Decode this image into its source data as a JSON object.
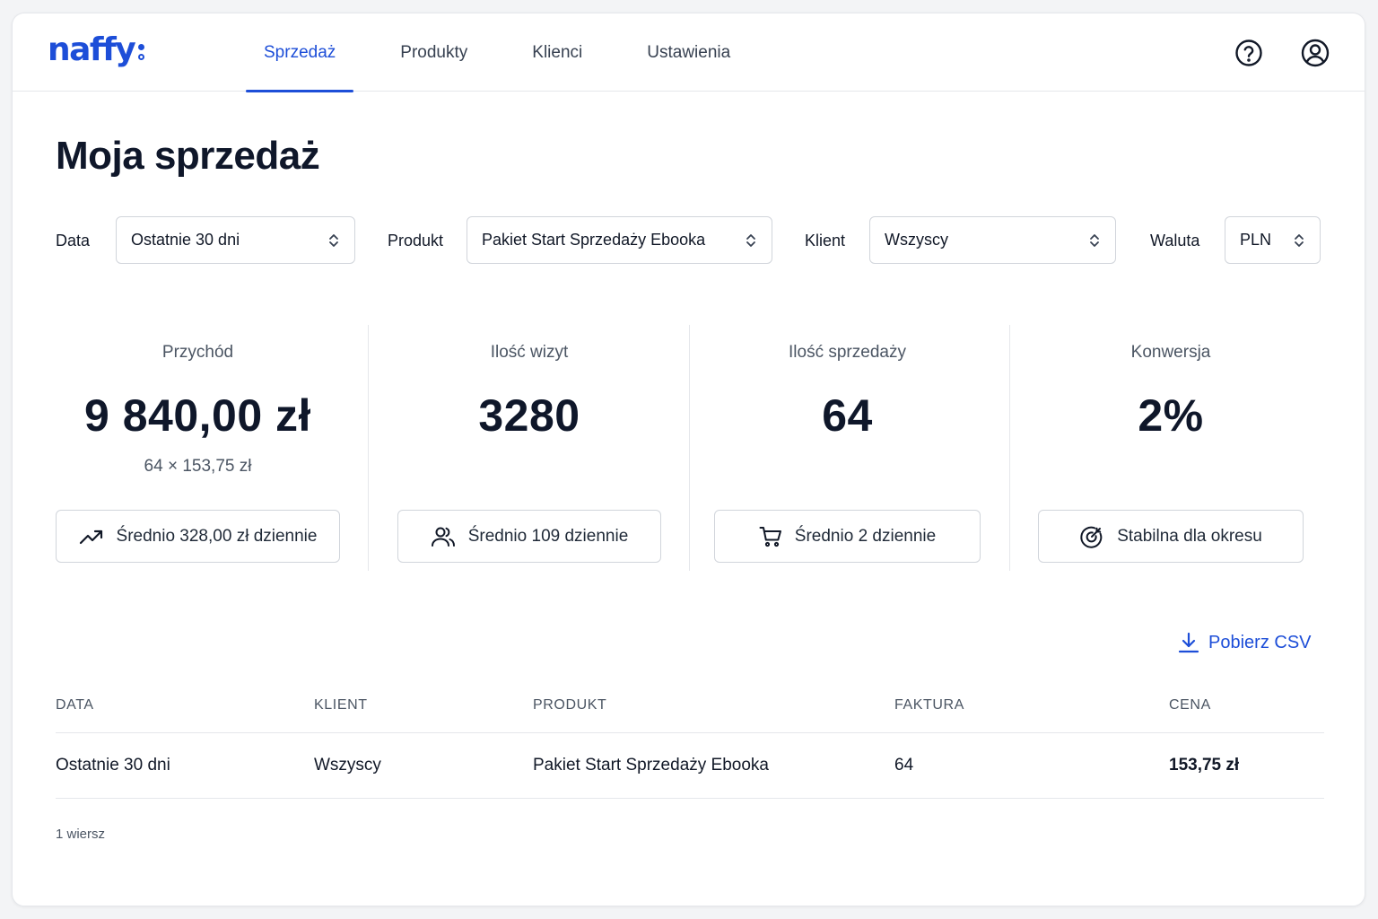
{
  "brand": {
    "name": "naffy"
  },
  "nav": {
    "tabs": [
      {
        "label": "Sprzedaż",
        "active": true
      },
      {
        "label": "Produkty",
        "active": false
      },
      {
        "label": "Klienci",
        "active": false
      },
      {
        "label": "Ustawienia",
        "active": false
      }
    ]
  },
  "header": {
    "help_icon": "question-circle-icon",
    "user_icon": "user-circle-icon"
  },
  "page": {
    "title": "Moja sprzedaż"
  },
  "filters": {
    "date": {
      "label": "Data",
      "value": "Ostatnie 30 dni"
    },
    "product": {
      "label": "Produkt",
      "value": "Pakiet Start Sprzedaży Ebooka"
    },
    "client": {
      "label": "Klient",
      "value": "Wszyscy"
    },
    "currency": {
      "label": "Waluta",
      "value": "PLN"
    }
  },
  "stats": {
    "revenue": {
      "label": "Przychód",
      "value": "9 840,00 zł",
      "sub": "64 × 153,75 zł",
      "note": "Średnio 328,00 zł dziennie",
      "icon": "trending-up-icon"
    },
    "visits": {
      "label": "Ilość wizyt",
      "value": "3280",
      "note": "Średnio 109 dziennie",
      "icon": "users-icon"
    },
    "sales": {
      "label": "Ilość sprzedaży",
      "value": "64",
      "note": "Średnio 2 dziennie",
      "icon": "cart-icon"
    },
    "conversion": {
      "label": "Konwersja",
      "value": "2%",
      "note": "Stabilna dla okresu",
      "icon": "target-icon"
    }
  },
  "actions": {
    "csv_label": "Pobierz CSV",
    "csv_icon": "download-icon"
  },
  "table": {
    "headers": [
      "DATA",
      "KLIENT",
      "PRODUKT",
      "FAKTURA",
      "CENA"
    ],
    "rows": [
      [
        "Ostatnie 30 dni",
        "Wszyscy",
        "Pakiet Start Sprzedaży Ebooka",
        "64",
        "153,75 zł"
      ]
    ],
    "row_count": "1 wiersz"
  },
  "colors": {
    "accent": "#1d4ed8",
    "text": "#111827",
    "muted": "#4b5563",
    "border": "#d1d5db"
  }
}
